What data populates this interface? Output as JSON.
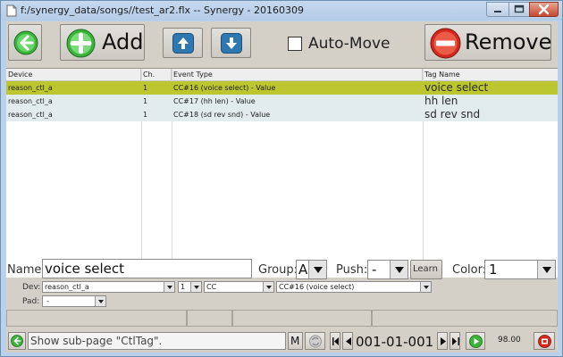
{
  "window": {
    "title": "f:/synergy_data/songs//test_ar2.flx -- Synergy - 20160309"
  },
  "toolbar": {
    "add_label": "Add",
    "automove_label": "Auto-Move",
    "automove_checked": false,
    "remove_label": "Remove"
  },
  "grid": {
    "columns": [
      "Device",
      "Ch.",
      "Event Type",
      "Tag Name"
    ],
    "rows": [
      {
        "device": "reason_ctl_a",
        "ch": "1",
        "event": "CC#16 (voice select) - Value",
        "tag": "voice select",
        "selected": true
      },
      {
        "device": "reason_ctl_a",
        "ch": "1",
        "event": "CC#17 (hh len) - Value",
        "tag": "hh len",
        "selected": false
      },
      {
        "device": "reason_ctl_a",
        "ch": "1",
        "event": "CC#18 (sd rev snd) - Value",
        "tag": "sd rev snd",
        "selected": false
      }
    ]
  },
  "form": {
    "name_label": "Name:",
    "name_value": "voice select",
    "group_label": "Group:",
    "group_value": "A",
    "push_label": "Push:",
    "push_value": "-",
    "learn_label": "Learn",
    "color_label": "Color:",
    "color_value": "1",
    "dev_label": "Dev:",
    "dev_value": "reason_ctl_a",
    "ch_value": "1",
    "type_value": "CC",
    "event_value": "CC#16 (voice select)",
    "pad_label": "Pad:",
    "pad_value": "-"
  },
  "bottom": {
    "status_text": "Show sub-page \"CtlTag\".",
    "m_label": "M",
    "position": "001-01-001",
    "tempo": "98.00"
  },
  "colors": {
    "selected_row": "#bcc62f",
    "row_alt": "#e3ecec",
    "accent_green": "#3bb33b",
    "accent_red": "#d42a1e",
    "accent_blue": "#2f77b0"
  }
}
